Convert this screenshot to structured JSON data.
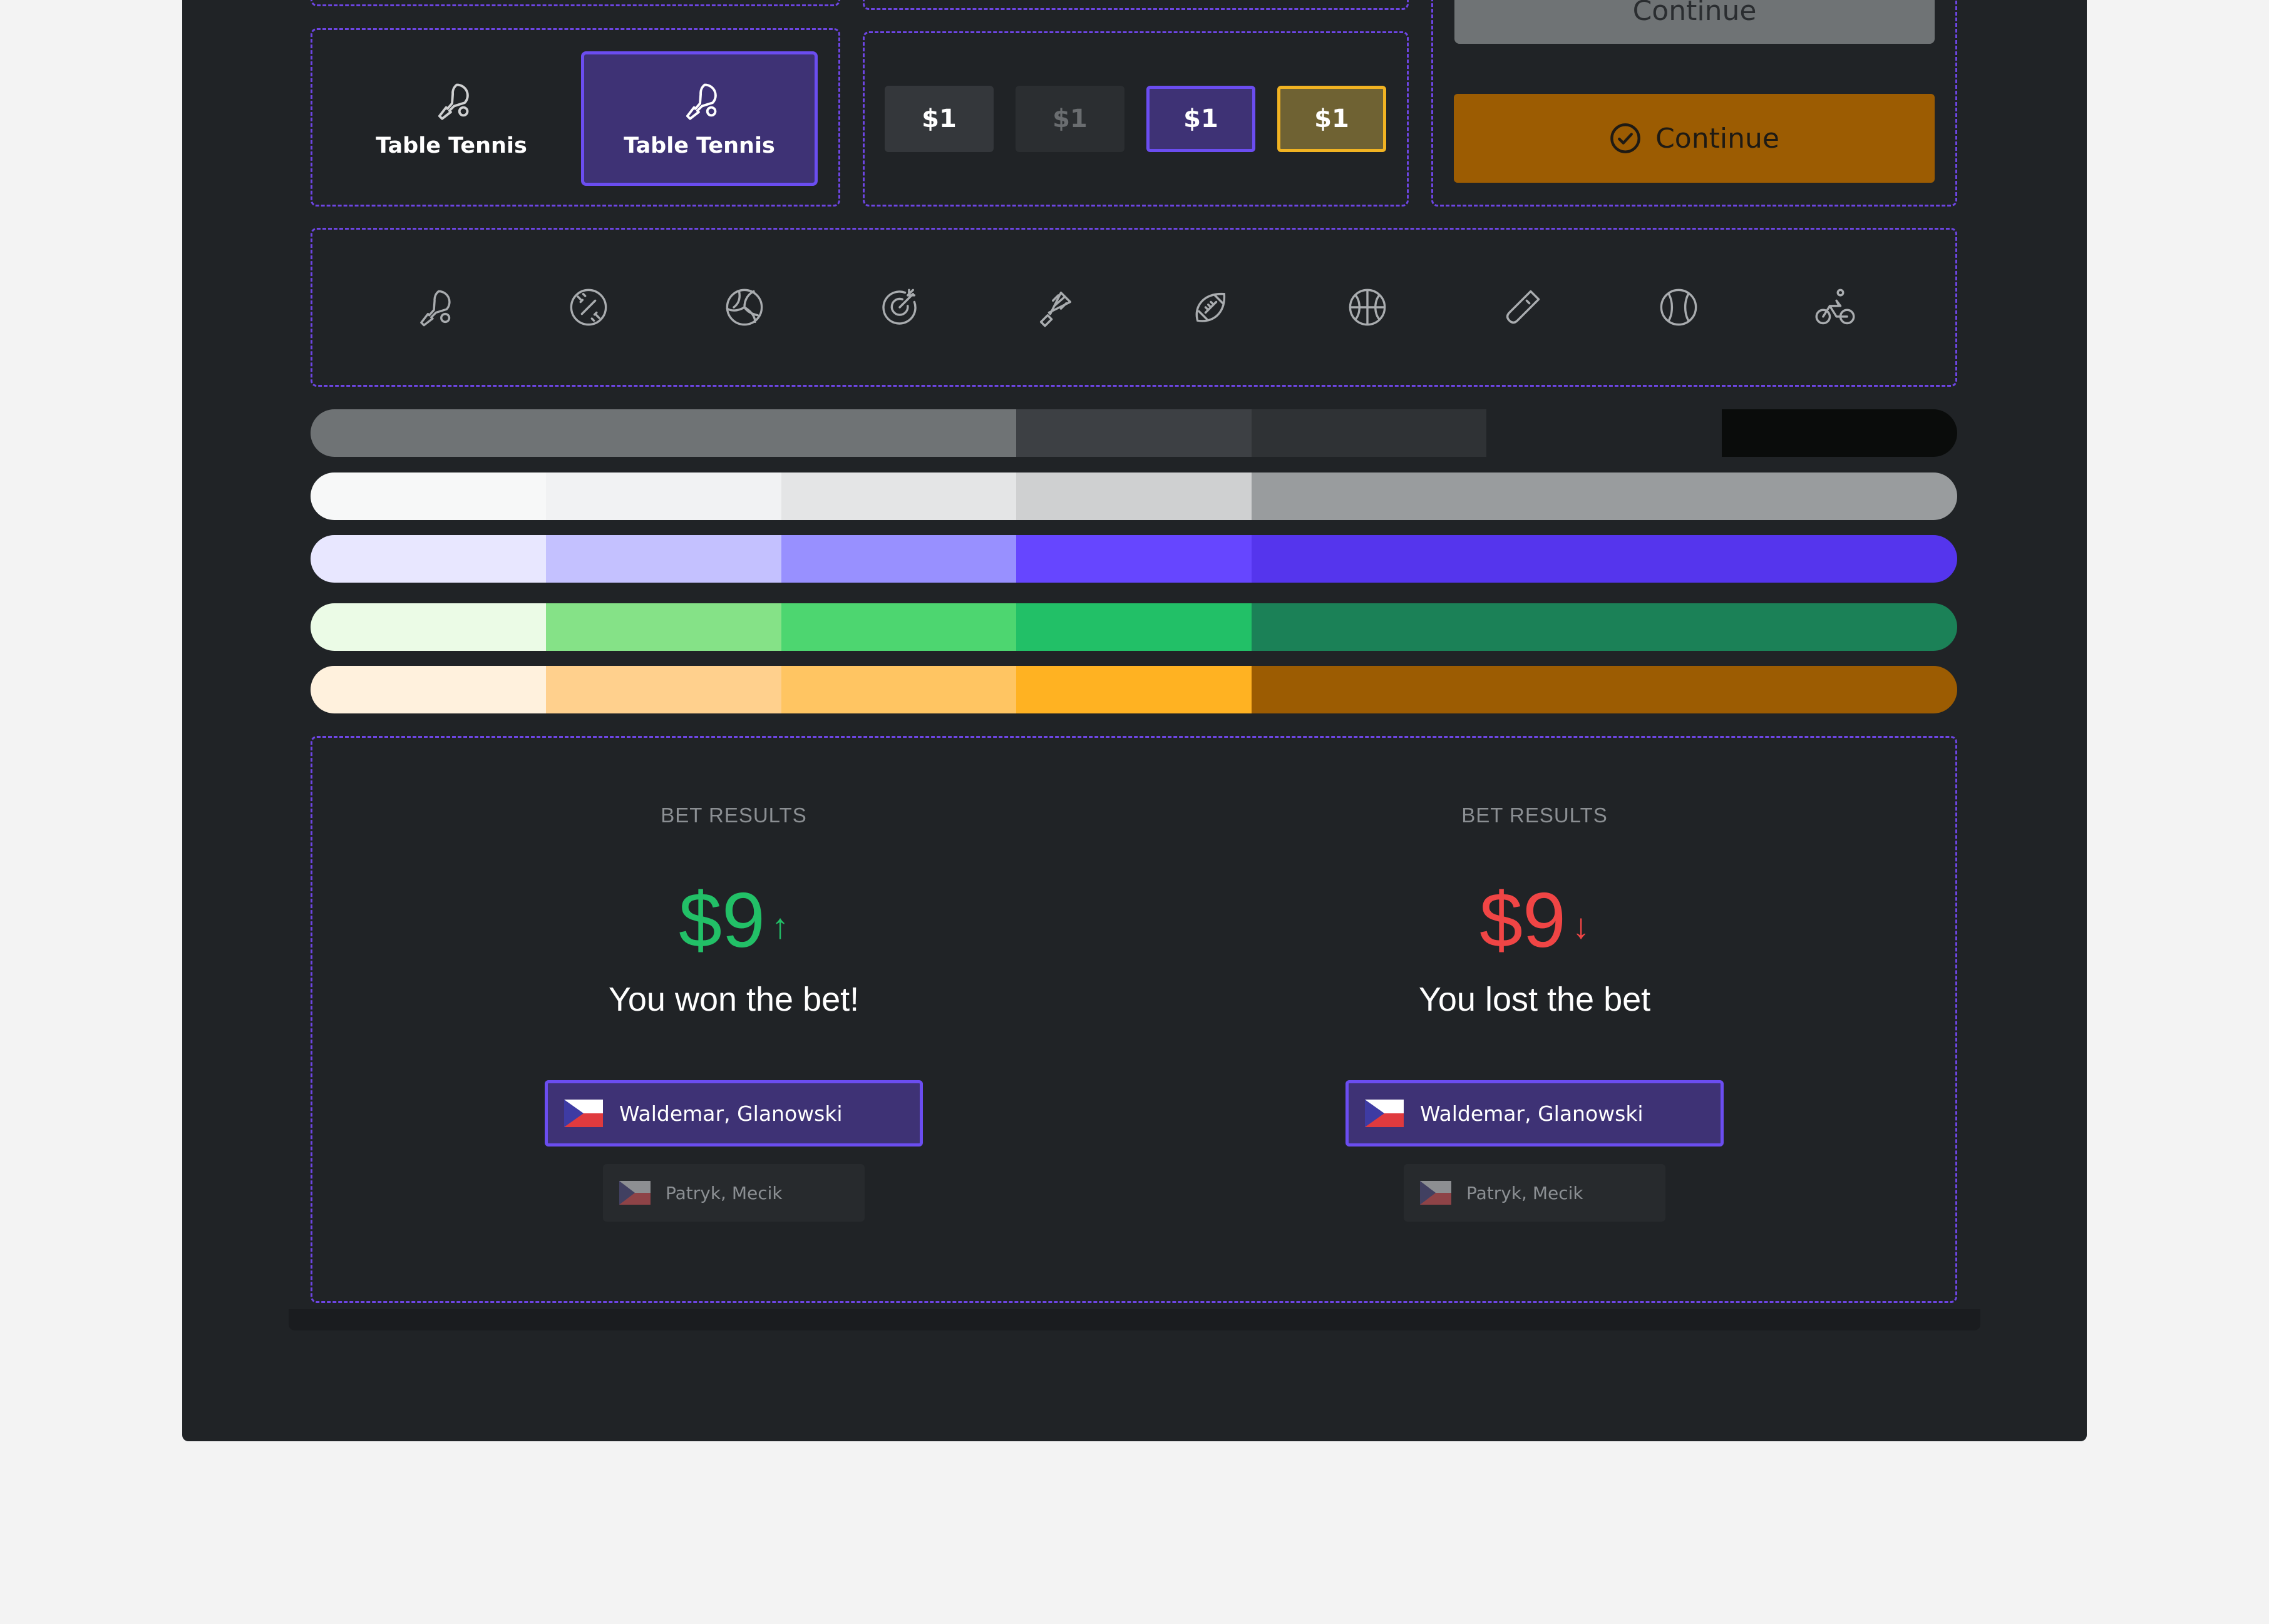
{
  "top_row": {
    "partial_button_label": "Continue"
  },
  "sport_selector": {
    "options": [
      {
        "label": "Table Tennis",
        "icon": "table-tennis-icon",
        "selected": false
      },
      {
        "label": "Table Tennis",
        "icon": "table-tennis-icon",
        "selected": true
      }
    ]
  },
  "price_chips": [
    {
      "label": "$1",
      "state": "default"
    },
    {
      "label": "$1",
      "state": "disabled"
    },
    {
      "label": "$1",
      "state": "selected"
    },
    {
      "label": "$1",
      "state": "highlighted"
    }
  ],
  "continue_button": {
    "label": "Continue",
    "icon": "check-circle-icon",
    "color": "#9c5c02"
  },
  "sport_icons": [
    "table-tennis-icon",
    "baseball-icon",
    "volleyball-icon",
    "darts-icon",
    "badminton-icon",
    "american-football-icon",
    "basketball-icon",
    "cricket-icon",
    "tennis-ball-icon",
    "cycling-icon"
  ],
  "palette": {
    "neutral_dark": [
      "#6f7375",
      "#6f7375",
      "#6f7375",
      "#3d4044",
      "#2f3235",
      "#202326",
      "#0a0c0b"
    ],
    "neutral_light": [
      "#f7f8f8",
      "#f1f2f3",
      "#e4e5e6",
      "#cfd0d1",
      "#999c9e",
      "#999c9e",
      "#999c9e"
    ],
    "accent_purple": [
      "#e8e7ff",
      "#c4c1ff",
      "#9890ff",
      "#6646ff",
      "#5535ed",
      "#5535ed",
      "#5535ed"
    ],
    "success_green": [
      "#ebfbe6",
      "#85e287",
      "#4dd670",
      "#22c067",
      "#1b8157",
      "#1b8157",
      "#1b8157"
    ],
    "warning_orange": [
      "#fff1dd",
      "#ffd08d",
      "#ffc562",
      "#ffb222",
      "#9c5c02",
      "#9c5c02",
      "#9c5c02"
    ]
  },
  "bet_results": [
    {
      "label": "BET RESULTS",
      "amount": "$9",
      "direction": "↑",
      "message": "You won the bet!",
      "color": "#22c067",
      "players": [
        {
          "name": "Waldemar, Glanowski",
          "flag": "czech-flag-icon"
        },
        {
          "name": "Patryk, Mecik",
          "flag": "czech-flag-icon"
        }
      ]
    },
    {
      "label": "BET RESULTS",
      "amount": "$9",
      "direction": "↓",
      "message": "You lost the bet",
      "color": "#f04545",
      "players": [
        {
          "name": "Waldemar, Glanowski",
          "flag": "czech-flag-icon"
        },
        {
          "name": "Patryk, Mecik",
          "flag": "czech-flag-icon"
        }
      ]
    }
  ]
}
